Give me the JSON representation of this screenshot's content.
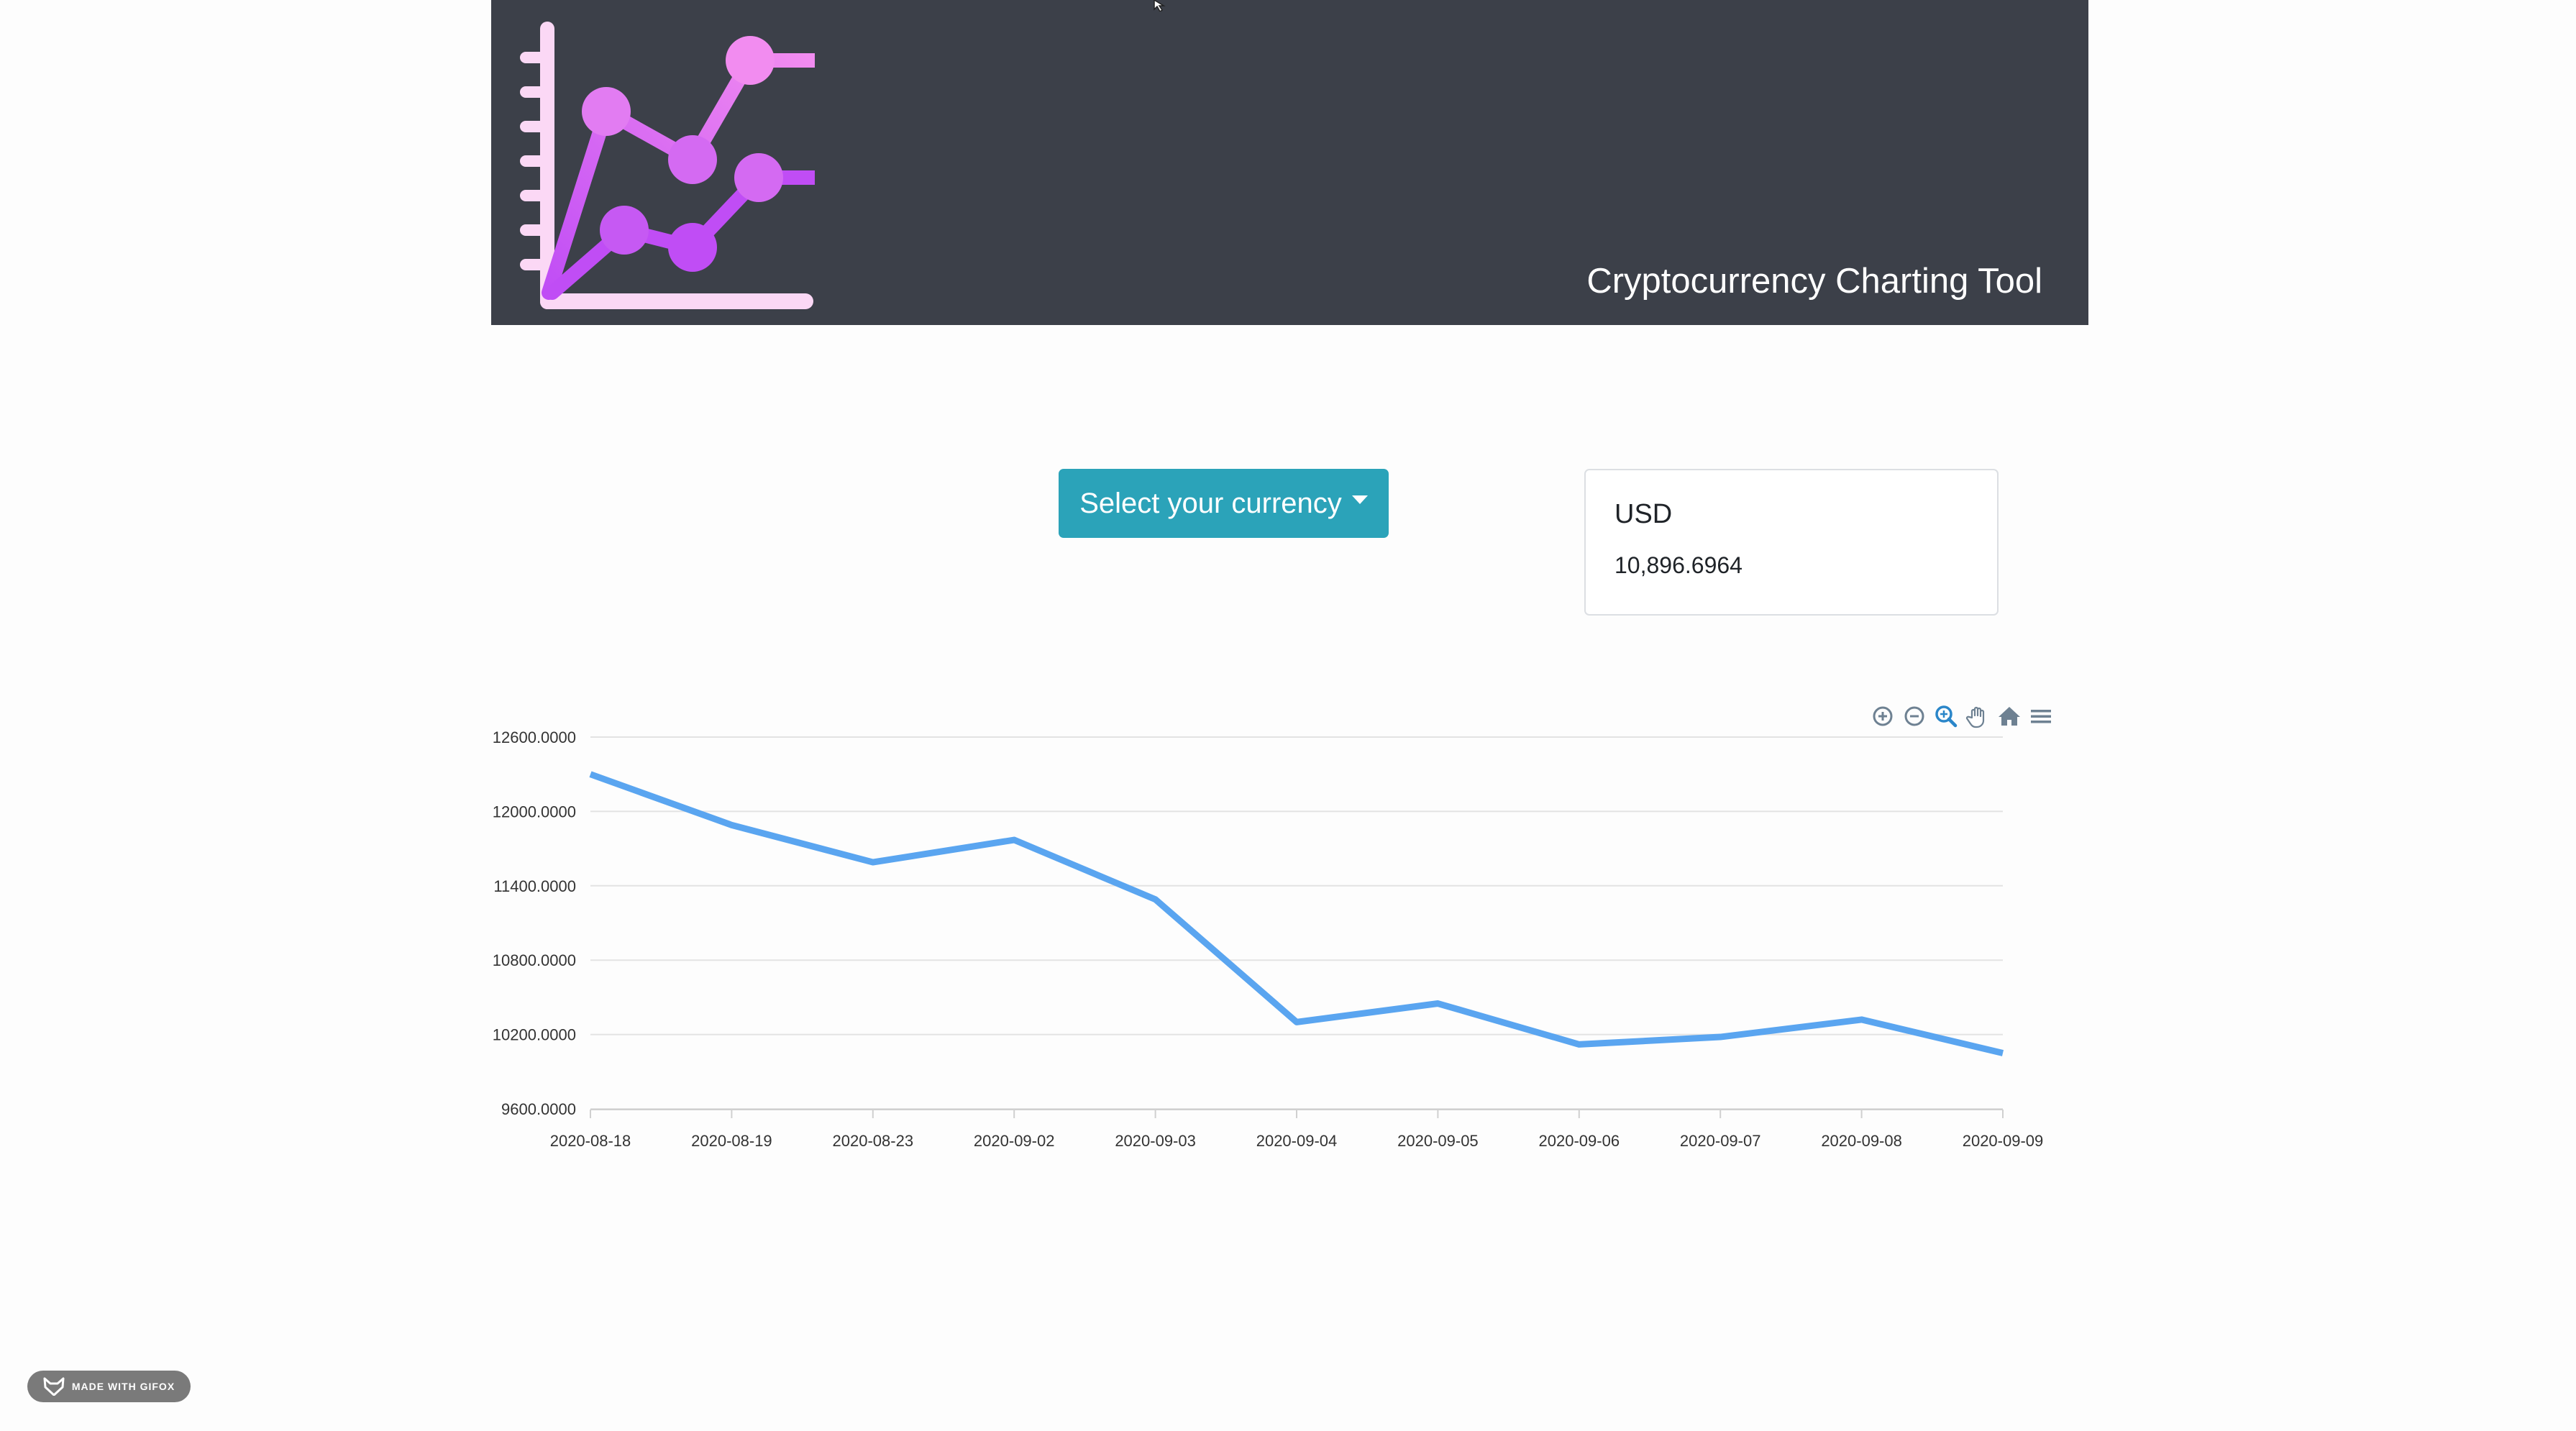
{
  "header": {
    "title": "Cryptocurrency Charting Tool"
  },
  "controls": {
    "dropdown_label": "Select your currency"
  },
  "price_card": {
    "currency": "USD",
    "value": "10,896.6964"
  },
  "toolbar": {
    "icons": [
      "zoom-in-icon",
      "zoom-out-icon",
      "selection-zoom-icon",
      "pan-icon",
      "reset-zoom-icon",
      "menu-icon"
    ]
  },
  "badge": {
    "label": "MADE WITH GIFOX"
  },
  "colors": {
    "header_bg": "#3c4049",
    "button_bg": "#2ba3b9",
    "series_line": "#5aa5f0"
  },
  "chart_data": {
    "type": "line",
    "categories": [
      "2020-08-18",
      "2020-08-19",
      "2020-08-23",
      "2020-09-02",
      "2020-09-03",
      "2020-09-04",
      "2020-09-05",
      "2020-09-06",
      "2020-09-07",
      "2020-09-08",
      "2020-09-09"
    ],
    "series": [
      {
        "values": [
          12300,
          11890,
          11590,
          11770,
          11290,
          10300,
          10450,
          10120,
          10180,
          10320,
          10050
        ]
      }
    ],
    "y_ticks": [
      "9600.0000",
      "10200.0000",
      "10800.0000",
      "11400.0000",
      "12000.0000",
      "12600.0000"
    ],
    "ylim": [
      9600,
      12600
    ],
    "grid": true,
    "legend": "none"
  }
}
